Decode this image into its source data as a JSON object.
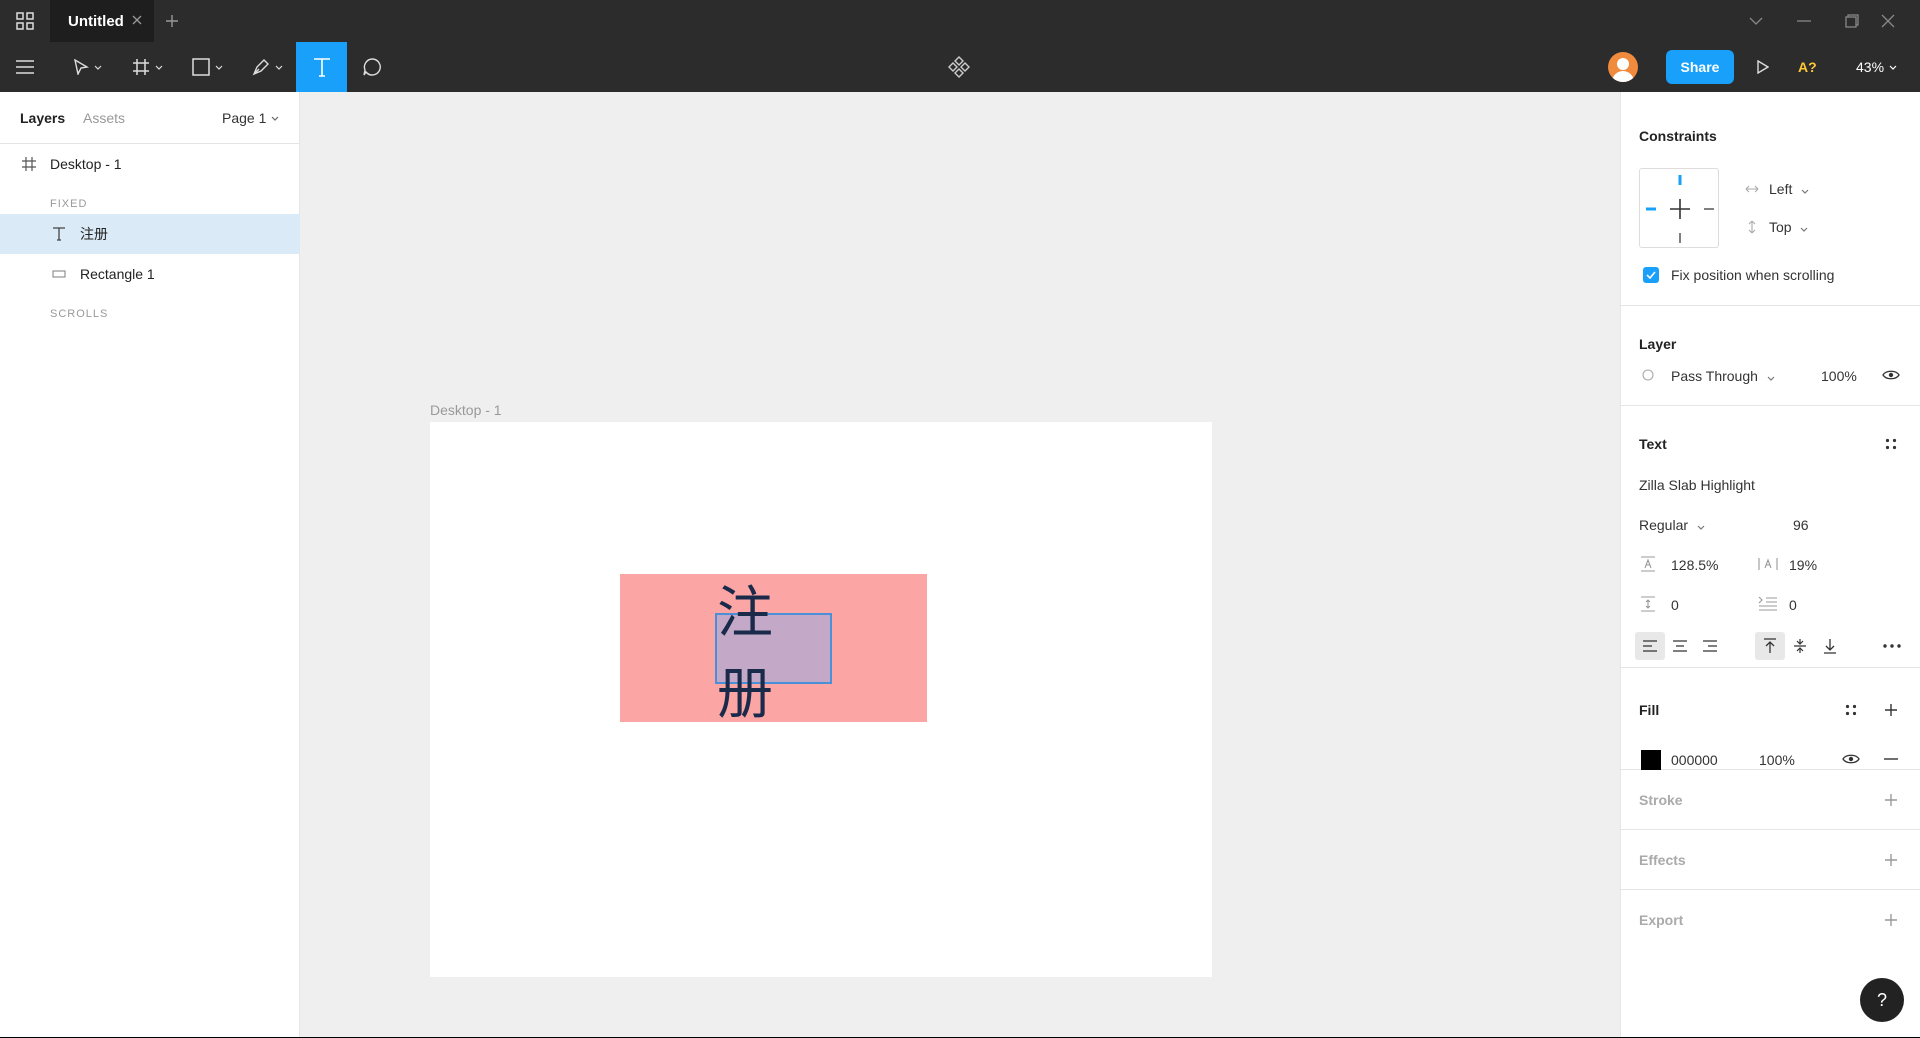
{
  "titlebar": {
    "tab_title": "Untitled"
  },
  "toolbar": {
    "share_label": "Share",
    "a_label": "A?",
    "zoom": "43%"
  },
  "left_panel": {
    "tab_layers": "Layers",
    "tab_assets": "Assets",
    "page": "Page 1",
    "layers": {
      "frame": "Desktop - 1",
      "fixed_label": "FIXED",
      "text_layer": "注册",
      "rect_layer": "Rectangle 1",
      "scrolls_label": "SCROLLS"
    }
  },
  "canvas": {
    "frame_label": "Desktop - 1",
    "text": "注册",
    "colors": {
      "rect": "#fca5a5",
      "frame": "#ffffff",
      "background": "#efefef"
    }
  },
  "right_panel": {
    "constraints": {
      "title": "Constraints",
      "horizontal": "Left",
      "vertical": "Top",
      "fix_position": "Fix position when scrolling"
    },
    "layer": {
      "title": "Layer",
      "blend": "Pass Through",
      "opacity": "100%"
    },
    "text": {
      "title": "Text",
      "font": "Zilla Slab Highlight",
      "weight": "Regular",
      "size": "96",
      "line_height": "128.5%",
      "letter_spacing": "19%",
      "paragraph_spacing": "0",
      "paragraph_indent": "0"
    },
    "fill": {
      "title": "Fill",
      "hex": "000000",
      "opacity": "100%"
    },
    "stroke": {
      "title": "Stroke"
    },
    "effects": {
      "title": "Effects"
    },
    "export": {
      "title": "Export"
    }
  },
  "help": {
    "label": "?"
  }
}
